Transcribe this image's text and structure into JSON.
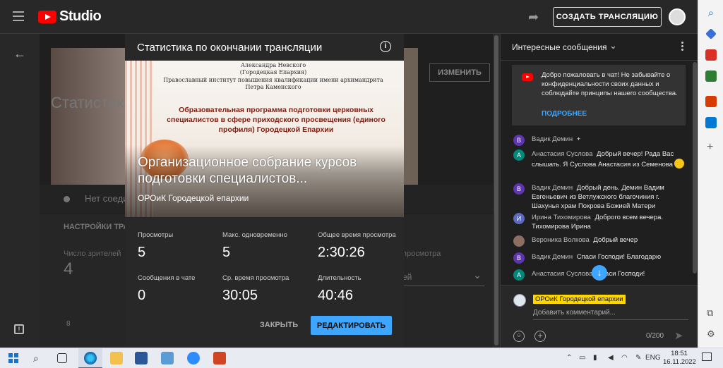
{
  "app": {
    "name": "Studio",
    "create_button": "СОЗДАТЬ ТРАНСЛЯЦИЮ"
  },
  "background_page": {
    "title": "Статистика трансляци",
    "change_button": "ИЗМЕНИТЬ",
    "status_text": "Нет соеди",
    "settings_title": "НАСТРОЙКИ ТРАН",
    "viewers_label": "Число зрителей",
    "viewers_value": "4",
    "right_label": "просмотра",
    "select_value": "ей",
    "axis_value": "8",
    "side_number": "2"
  },
  "modal": {
    "title": "Статистика по окончании трансляции",
    "thumbnail": {
      "slide_lines": [
        "Александра Невского",
        "(Городецкая Епархия)",
        "Православный институт повышения квалификации имени архимандрита",
        "Петра Каменского"
      ],
      "slide_red": "Образовательная программа подготовки церковных специалистов в сфере приходского просвещения (единого профиля) Городецкой Епархии",
      "stream_title": "Организационное собрание курсов подготовки специалистов...",
      "channel": "ОРОиК Городецкой епархии"
    },
    "stats": [
      {
        "label": "Просмотры",
        "value": "5"
      },
      {
        "label": "Макс. одновременно",
        "value": "5"
      },
      {
        "label": "Общее время просмотра",
        "value": "2:30:26"
      },
      {
        "label": "Сообщения в чате",
        "value": "0"
      },
      {
        "label": "Ср. время просмотра",
        "value": "30:05"
      },
      {
        "label": "Длительность",
        "value": "40:46"
      }
    ],
    "close_button": "ЗАКРЫТЬ",
    "edit_button": "РЕДАКТИРОВАТЬ"
  },
  "chat": {
    "header": "Интересные сообщения",
    "welcome_text": "Добро пожаловать в чат! Не забывайте о конфиденциальности своих данных и соблюдайте принципы нашего сообщества.",
    "welcome_more": "ПОДРОБНЕЕ",
    "messages": [
      {
        "initial": "В",
        "author": "Вадик Демин",
        "text": "+",
        "color": "#5e35b1"
      },
      {
        "initial": "А",
        "author": "Анастасия Суслова",
        "text": "Добрый вечер! Рада Вас слышать. Я Суслова Анастасия из Семенова",
        "color": "#00897b"
      },
      {
        "initial": "В",
        "author": "Вадик Демин",
        "text": "Добрый день. Демин Вадим Евгеньевич из Ветлужского благочиния г. Шахунья храм Покрова Божией Матери",
        "color": "#5e35b1"
      },
      {
        "initial": "И",
        "author": "Ирина Тихомирова",
        "text": "Доброго всем вечера. Тихомирова Ирина",
        "color": "#5c6bc0"
      },
      {
        "initial": "",
        "author": "Вероника Волкова",
        "text": "Добрый вечер",
        "color": "#8d6e63"
      },
      {
        "initial": "В",
        "author": "Вадик Демин",
        "text": "Спаси Господи! Благодарю",
        "color": "#5e35b1"
      },
      {
        "initial": "А",
        "author": "Анастасия Суслова",
        "text": "Спаси Господи!",
        "color": "#00897b"
      }
    ],
    "composer": {
      "name": "ОРОиК Городецкой епархии",
      "placeholder": "Добавить комментарий...",
      "counter": "0/200"
    }
  },
  "taskbar": {
    "language": "ENG",
    "time": "18:51",
    "date": "16.11.2022"
  }
}
